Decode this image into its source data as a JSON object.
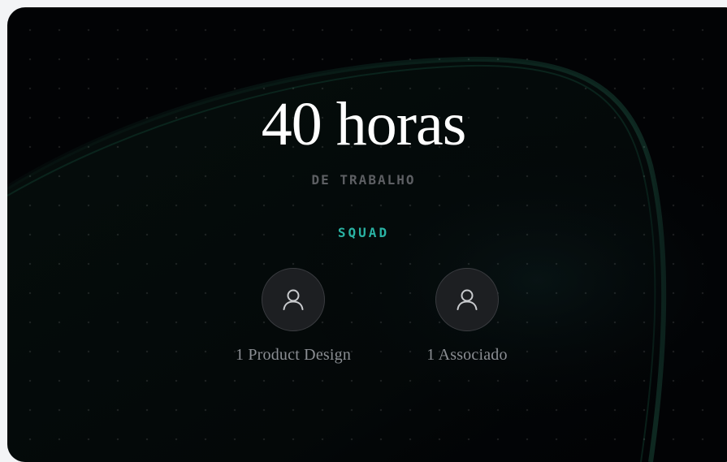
{
  "hero": {
    "title": "40 horas",
    "subtitle": "DE TRABALHO"
  },
  "squad": {
    "label": "SQUAD",
    "members": [
      {
        "label": "1 Product Design",
        "icon": "user-icon"
      },
      {
        "label": "1 Associado",
        "icon": "user-icon"
      }
    ]
  },
  "colors": {
    "background": "#020305",
    "accent": "#2ab3a4",
    "glow": "#1f5c48"
  }
}
